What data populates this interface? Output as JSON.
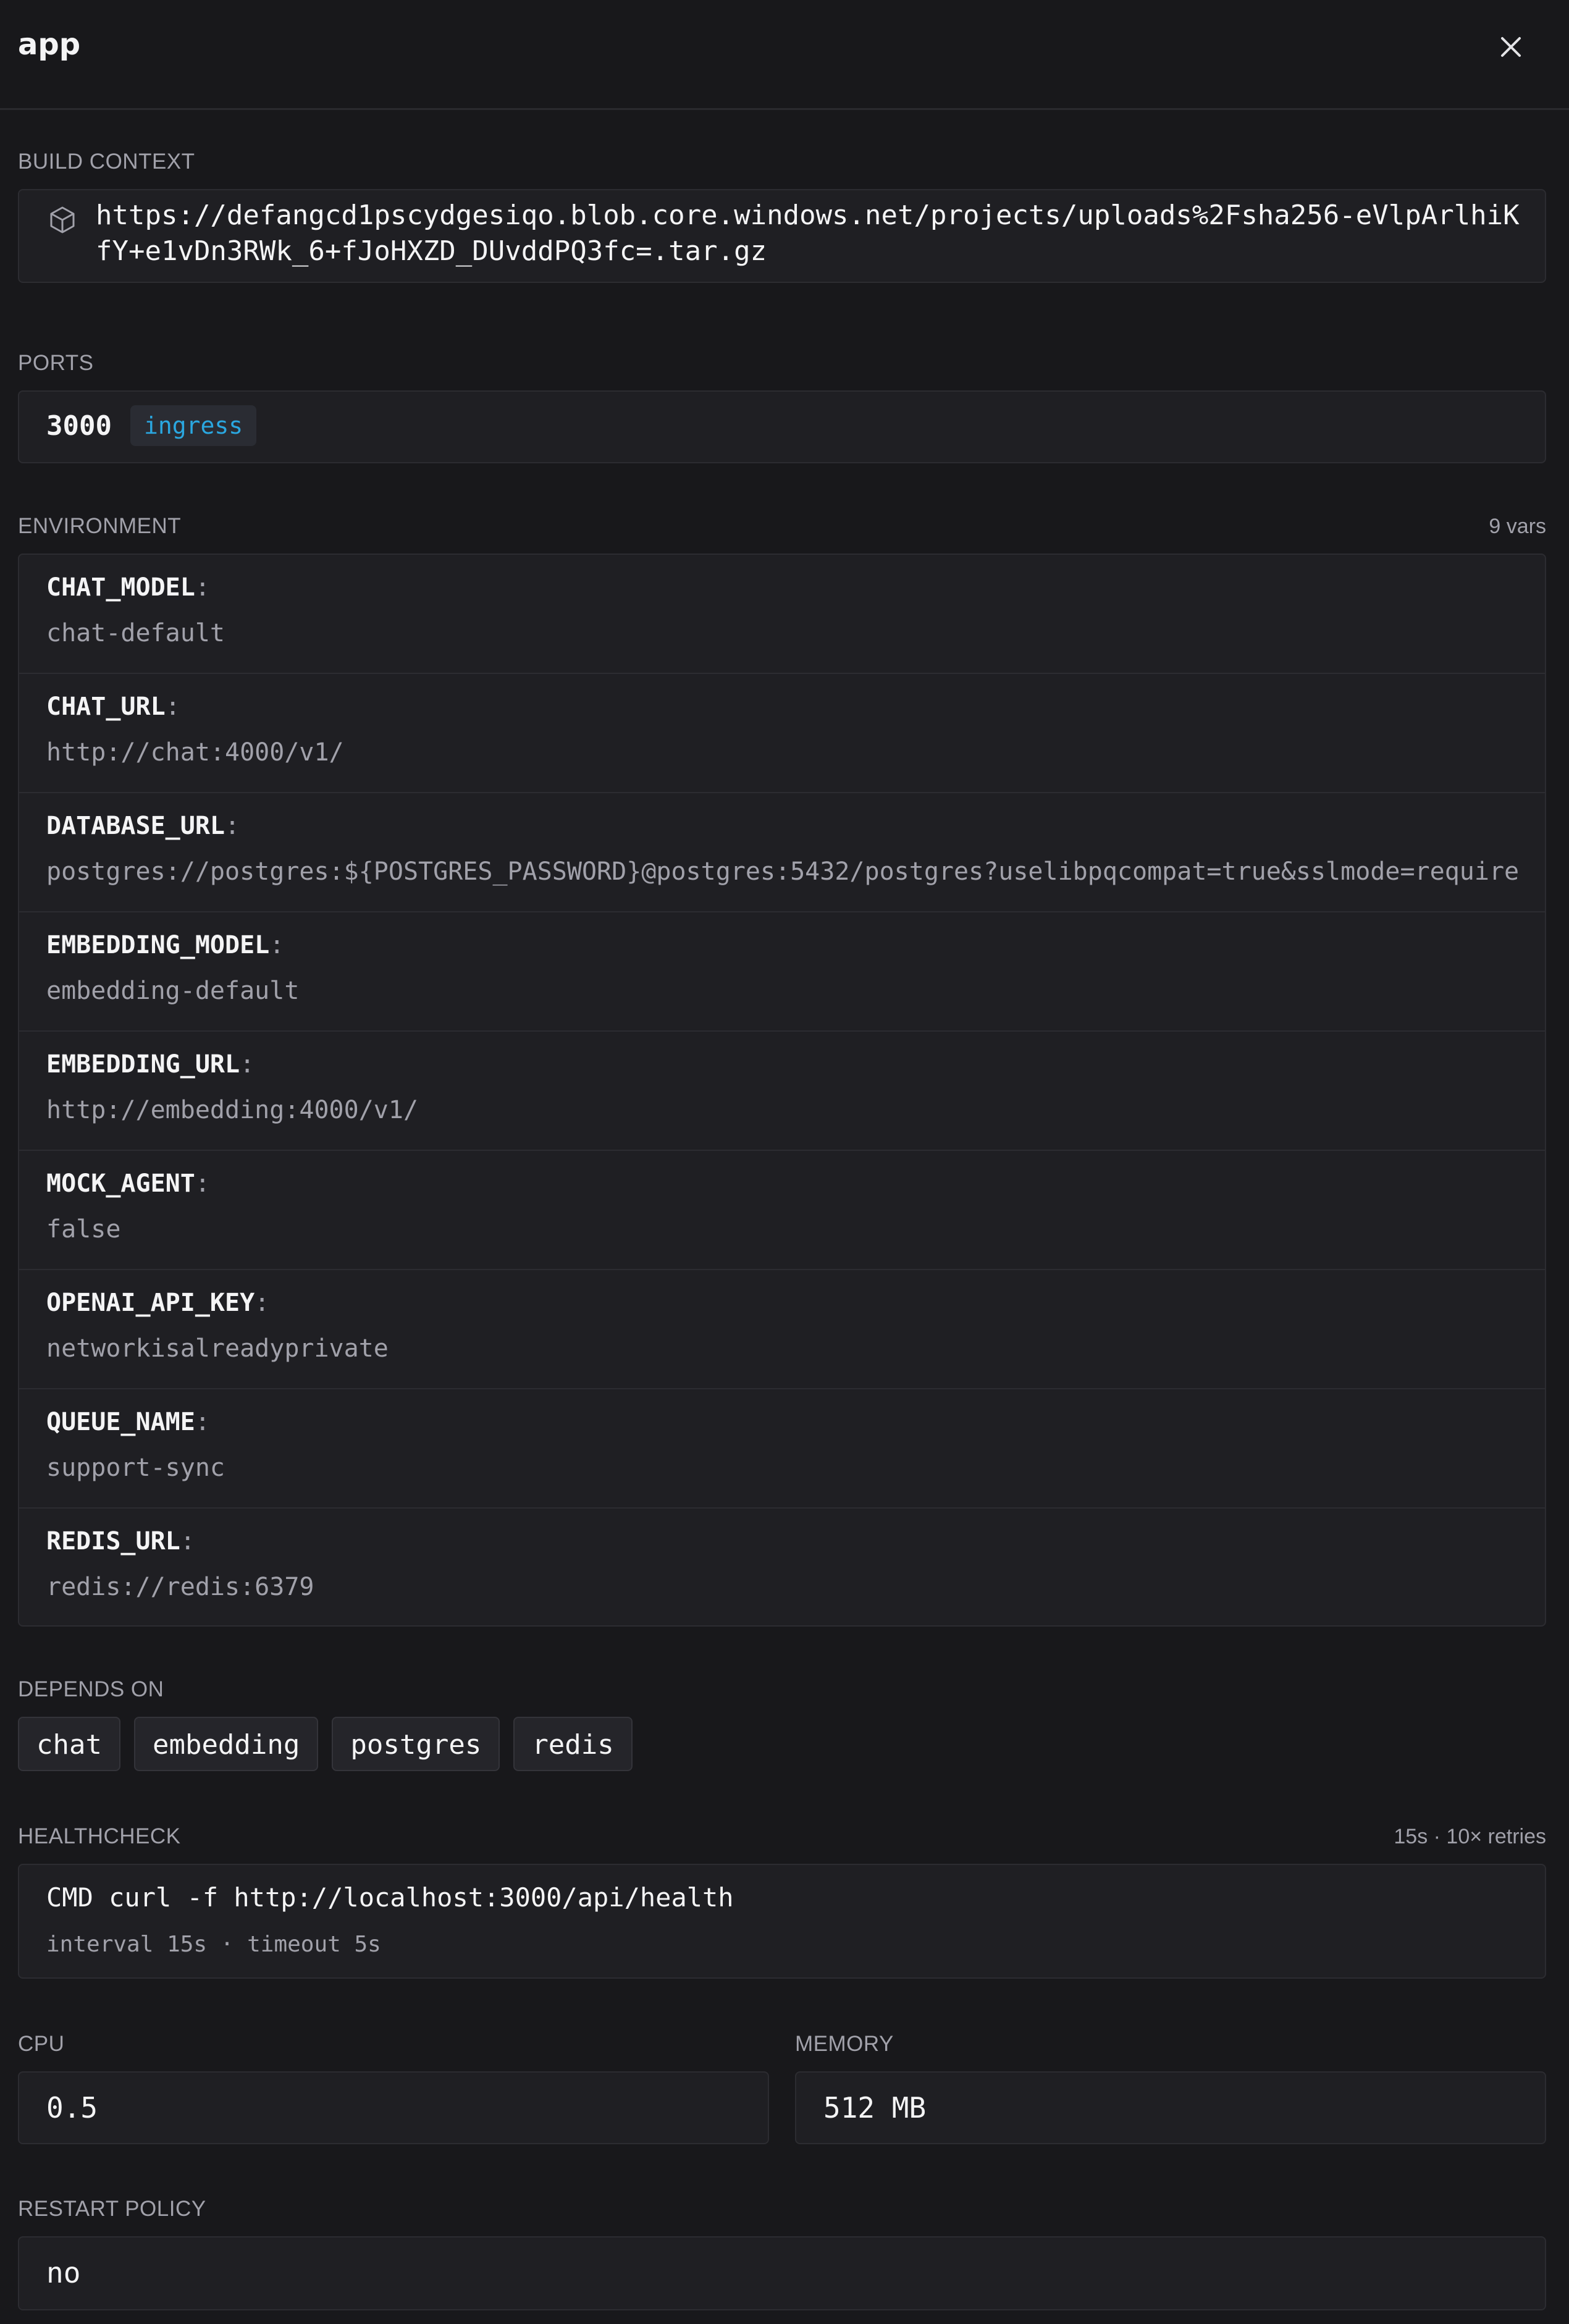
{
  "header": {
    "title": "app",
    "close_icon": "close-icon"
  },
  "build_context": {
    "label": "BUILD CONTEXT",
    "icon": "package-icon",
    "url": "https://defangcd1pscydgesiqo.blob.core.windows.net/projects/uploads%2Fsha256-eVlpArlhiKfY+e1vDn3RWk_6+fJoHXZD_DUvddPQ3fc=.tar.gz"
  },
  "ports": {
    "label": "PORTS",
    "items": [
      {
        "port": "3000",
        "mode": "ingress"
      }
    ]
  },
  "environment": {
    "label": "ENVIRONMENT",
    "count": "9 vars",
    "vars": [
      {
        "key": "CHAT_MODEL",
        "value": "chat-default"
      },
      {
        "key": "CHAT_URL",
        "value": "http://chat:4000/v1/"
      },
      {
        "key": "DATABASE_URL",
        "value": "postgres://postgres:${POSTGRES_PASSWORD}@postgres:5432/postgres?uselibpqcompat=true&sslmode=require"
      },
      {
        "key": "EMBEDDING_MODEL",
        "value": "embedding-default"
      },
      {
        "key": "EMBEDDING_URL",
        "value": "http://embedding:4000/v1/"
      },
      {
        "key": "MOCK_AGENT",
        "value": "false"
      },
      {
        "key": "OPENAI_API_KEY",
        "value": "networkisalreadyprivate"
      },
      {
        "key": "QUEUE_NAME",
        "value": "support-sync"
      },
      {
        "key": "REDIS_URL",
        "value": "redis://redis:6379"
      }
    ]
  },
  "depends_on": {
    "label": "DEPENDS ON",
    "items": [
      "chat",
      "embedding",
      "postgres",
      "redis"
    ]
  },
  "healthcheck": {
    "label": "HEALTHCHECK",
    "meta": "15s · 10× retries",
    "command": "CMD curl -f http://localhost:3000/api/health",
    "details": "interval 15s · timeout 5s"
  },
  "cpu": {
    "label": "CPU",
    "value": "0.5"
  },
  "memory": {
    "label": "MEMORY",
    "value": "512 MB"
  },
  "restart_policy": {
    "label": "RESTART POLICY",
    "value": "no"
  },
  "colors": {
    "background": "#18181b",
    "card": "#1f1f23",
    "border": "#2c2c31",
    "text": "#f4f4f5",
    "muted": "#a1a1aa",
    "accent": "#2aa7e0"
  }
}
